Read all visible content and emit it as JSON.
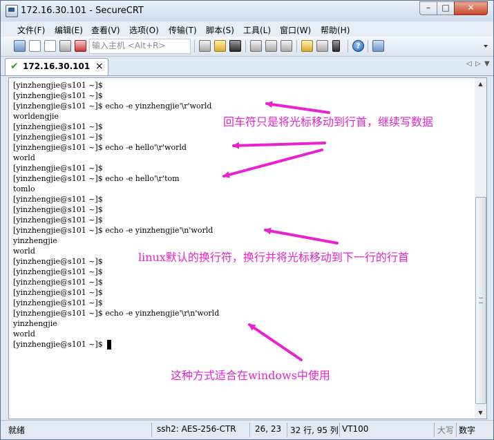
{
  "window": {
    "title": "172.16.30.101 - SecureCRT",
    "min_label": "–",
    "max_label": "□",
    "close_label": "✕"
  },
  "menu": [
    "文件(F)",
    "编辑(E)",
    "查看(V)",
    "选项(O)",
    "传输(T)",
    "脚本(S)",
    "工具(L)",
    "窗口(W)",
    "帮助(H)"
  ],
  "toolbar": {
    "quick_connect_placeholder": "输入主机 <Alt+R>",
    "icons": [
      "connect-icon",
      "quick-connect-icon",
      "connect-tab-icon",
      "reconnect-icon",
      "disconnect-icon",
      "copy-icon",
      "paste-icon",
      "find-icon",
      "print-icon",
      "print-setup-icon",
      "print-screen-icon",
      "session-options-icon",
      "global-options-icon",
      "key-map-icon",
      "help-icon",
      "sftp-icon"
    ]
  },
  "tab": {
    "label": "172.16.30.101",
    "close": "×",
    "nav_left": "◁",
    "nav_right": "▷",
    "nav_down": "▼",
    "status_color": "#2f9e2f"
  },
  "terminal": {
    "lines": [
      "[yinzhengjie@s101 ~]$",
      "[yinzhengjie@s101 ~]$",
      "[yinzhengjie@s101 ~]$ echo -e yinzhengjie'\\r'world",
      "worldengjie",
      "[yinzhengjie@s101 ~]$",
      "[yinzhengjie@s101 ~]$",
      "[yinzhengjie@s101 ~]$ echo -e hello'\\r'world",
      "world",
      "[yinzhengjie@s101 ~]$",
      "[yinzhengjie@s101 ~]$ echo -e hello'\\r'tom",
      "tomlo",
      "[yinzhengjie@s101 ~]$",
      "[yinzhengjie@s101 ~]$",
      "[yinzhengjie@s101 ~]$",
      "[yinzhengjie@s101 ~]$ echo -e yinzhengjie'\\n'world",
      "yinzhengjie",
      "world",
      "[yinzhengjie@s101 ~]$",
      "[yinzhengjie@s101 ~]$",
      "[yinzhengjie@s101 ~]$",
      "[yinzhengjie@s101 ~]$",
      "[yinzhengjie@s101 ~]$",
      "[yinzhengjie@s101 ~]$ echo -e yinzhengjie'\\r\\n'world",
      "yinzhengjie",
      "world",
      "[yinzhengjie@s101 ~]$"
    ]
  },
  "annotations": {
    "carriage_return": "回车符只是将光标移动到行首，继续写数据",
    "linux_newline": "linux默认的换行符，换行并将光标移动到下一行的行首",
    "windows_newline": "这种方式适合在windows中使用",
    "color": "#e822d0"
  },
  "statusbar": {
    "status": "就绪",
    "cipher": "ssh2: AES-256-CTR",
    "cursor_pos": "26,  23",
    "size": "32 行, 95 列",
    "terminal_type": "VT100",
    "caps": "大写",
    "num": "数字"
  }
}
